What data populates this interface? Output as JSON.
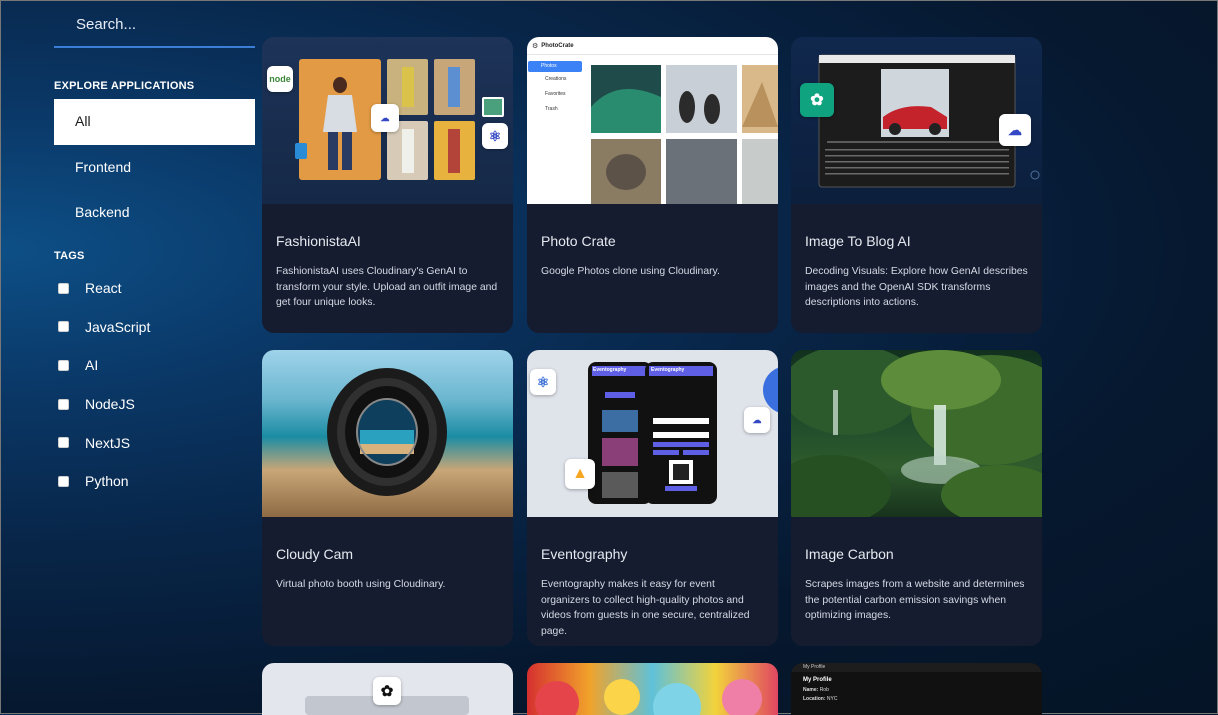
{
  "search": {
    "placeholder": "Search..."
  },
  "sidebar": {
    "explore_title": "EXPLORE APPLICATIONS",
    "apps": [
      "All",
      "Frontend",
      "Backend"
    ],
    "tags_title": "TAGS",
    "tags": [
      "React",
      "JavaScript",
      "AI",
      "NodeJS",
      "NextJS",
      "Python"
    ]
  },
  "cards": [
    {
      "title": "FashionistaAI",
      "desc": "FashionistaAI uses Cloudinary's GenAI to transform your style. Upload an outfit image and get four unique looks."
    },
    {
      "title": "Photo Crate",
      "desc": "Google Photos clone using Cloudinary."
    },
    {
      "title": "Image To Blog AI",
      "desc": "Decoding Visuals: Explore how GenAI describes images and the OpenAI SDK transforms descriptions into actions."
    },
    {
      "title": "Cloudy Cam",
      "desc": "Virtual photo booth using Cloudinary."
    },
    {
      "title": "Eventography",
      "desc": "Eventography makes it easy for event organizers to collect high-quality photos and videos from guests in one secure, centralized page."
    },
    {
      "title": "Image Carbon",
      "desc": "Scrapes images from a website and determines the potential carbon emission savings when optimizing images."
    }
  ],
  "photocrate": {
    "app_name": "PhotoCrate",
    "menu": [
      "Photos",
      "Creations",
      "Favorites",
      "Trash"
    ]
  },
  "eventography_app": {
    "title": "Eventography"
  },
  "profile_preview": {
    "nav": "My Profile",
    "heading": "My Profile",
    "name_label": "Name:",
    "name_value": "Rob",
    "location_label": "Location:",
    "location_value": "NYC"
  },
  "icons": {
    "node": "nodejs-logo-icon",
    "cloudinary": "cloudinary-icon",
    "react": "react-icon",
    "openai": "openai-icon",
    "firebase": "firebase-icon"
  }
}
